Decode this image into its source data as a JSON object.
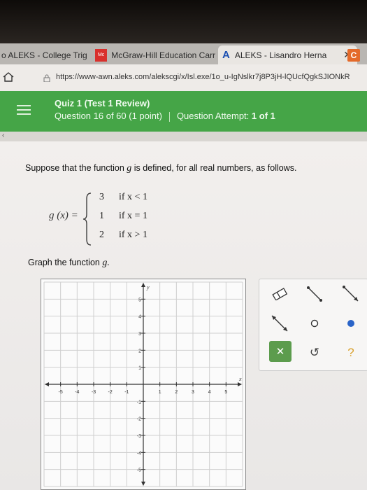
{
  "browser": {
    "tabs": [
      {
        "label": "o ALEKS - College Trig"
      },
      {
        "label": "McGraw-Hill Education Carr",
        "icon": "mcgraw-hill-logo-icon"
      },
      {
        "label": "ALEKS - Lisandro Herna",
        "icon": "aleks-logo-icon",
        "close": "✕"
      },
      {
        "label": "C",
        "icon": "c-app-icon"
      }
    ],
    "url": "https://www-awn.aleks.com/alekscgi/x/Isl.exe/1o_u-IgNslkr7j8P3jH-lQUcfQgkSJIONkR"
  },
  "quiz": {
    "title": "Quiz 1 (Test 1 Review)",
    "question": "Question 16 of 60 (1 point)",
    "attempt_label": "Question Attempt:",
    "attempt_value": "1 of 1"
  },
  "problem": {
    "prompt_before": "Suppose that the function ",
    "prompt_var": "g",
    "prompt_after": " is defined, for all real numbers, as follows.",
    "function_label": "g (x) =",
    "cases": [
      {
        "value": "3",
        "condition": "if x < 1"
      },
      {
        "value": "1",
        "condition": "if x = 1"
      },
      {
        "value": "2",
        "condition": "if x > 1"
      }
    ],
    "graph_prompt": "Graph the function ",
    "graph_var": "g."
  },
  "chart_data": {
    "type": "scatter",
    "title": "",
    "xlabel": "x",
    "ylabel": "y",
    "xlim": [
      -6,
      6
    ],
    "ylim": [
      -6,
      6
    ],
    "x_ticks": [
      "-5",
      "-4",
      "-3",
      "-2",
      "-1",
      "1",
      "2",
      "3",
      "4",
      "5"
    ],
    "y_ticks": [
      "5",
      "4",
      "3",
      "2",
      "1",
      "-1",
      "-2",
      "-3",
      "-4",
      "-5"
    ],
    "grid": true,
    "series": []
  },
  "tools": {
    "items": [
      "eraser-icon",
      "segment-tool-icon",
      "ray-tool-icon",
      "line-tool-icon",
      "open-point-icon",
      "closed-point-icon"
    ],
    "clear": "✕",
    "undo": "↺",
    "help": "?"
  },
  "colors": {
    "quiz_header": "#45a547",
    "closed_point": "#2a64c8",
    "help": "#d9a02b"
  }
}
